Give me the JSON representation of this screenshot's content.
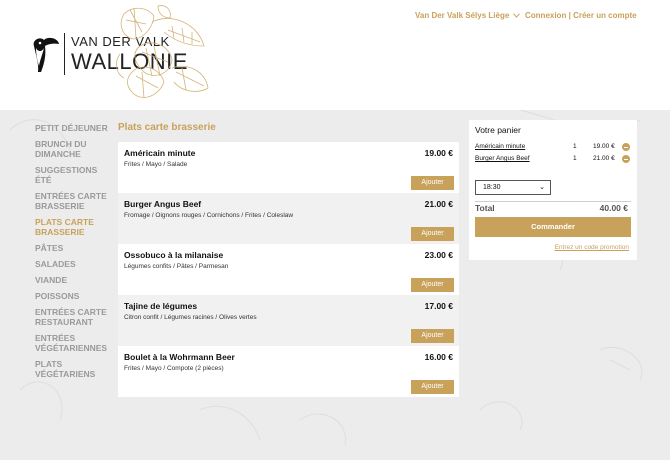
{
  "header": {
    "logo_line1": "VAN DER VALK",
    "logo_line2": "WALLONIE",
    "location_label": "Van Der Valk Sélys Liège",
    "login_label": "Connexion",
    "separator": "|",
    "signup_label": "Créer un compte"
  },
  "sidebar": {
    "items": [
      {
        "label": "PETIT DÉJEUNER",
        "active": false
      },
      {
        "label": "BRUNCH DU DIMANCHE",
        "active": false
      },
      {
        "label": "SUGGESTIONS ÉTÉ",
        "active": false
      },
      {
        "label": "ENTRÉES CARTE BRASSERIE",
        "active": false
      },
      {
        "label": "PLATS CARTE BRASSERIE",
        "active": true
      },
      {
        "label": "PÂTES",
        "active": false
      },
      {
        "label": "SALADES",
        "active": false
      },
      {
        "label": "VIANDE",
        "active": false
      },
      {
        "label": "POISSONS",
        "active": false
      },
      {
        "label": "ENTRÉES CARTE RESTAURANT",
        "active": false
      },
      {
        "label": "ENTRÉES VÉGÉTARIENNES",
        "active": false
      },
      {
        "label": "PLATS VÉGÉTARIENS",
        "active": false
      }
    ]
  },
  "menu": {
    "section_title": "Plats carte brasserie",
    "add_label": "Ajouter",
    "products": [
      {
        "name": "Américain minute",
        "description": "Frites / Mayo / Salade",
        "price": "19.00 €"
      },
      {
        "name": "Burger Angus Beef",
        "description": "Fromage / Oignons rouges / Cornichons / Frites / Coleslaw",
        "price": "21.00 €"
      },
      {
        "name": "Ossobuco à la milanaise",
        "description": "Légumes confits / Pâtes / Parmesan",
        "price": "23.00 €"
      },
      {
        "name": "Tajine de légumes",
        "description": "Citron confit / Légumes racines / Olives vertes",
        "price": "17.00 €"
      },
      {
        "name": "Boulet à la Wohrmann Beer",
        "description": "Frites / Mayo / Compote (2 pièces)",
        "price": "16.00 €"
      }
    ]
  },
  "cart": {
    "title": "Votre panier",
    "items": [
      {
        "name": "Américain minute",
        "qty": "1",
        "price": "19.00 €"
      },
      {
        "name": "Burger Angus Beef",
        "qty": "1",
        "price": "21.00 €"
      }
    ],
    "time_value": "18:30",
    "total_label": "Total",
    "total_value": "40.00 €",
    "order_label": "Commander",
    "promo_label": "Entrez un code promotion"
  },
  "colors": {
    "accent": "#c8a25b",
    "background": "#ececec",
    "panel": "#ffffff",
    "row_alt": "#f1f1f1",
    "nav_inactive": "#9a9a9a"
  }
}
